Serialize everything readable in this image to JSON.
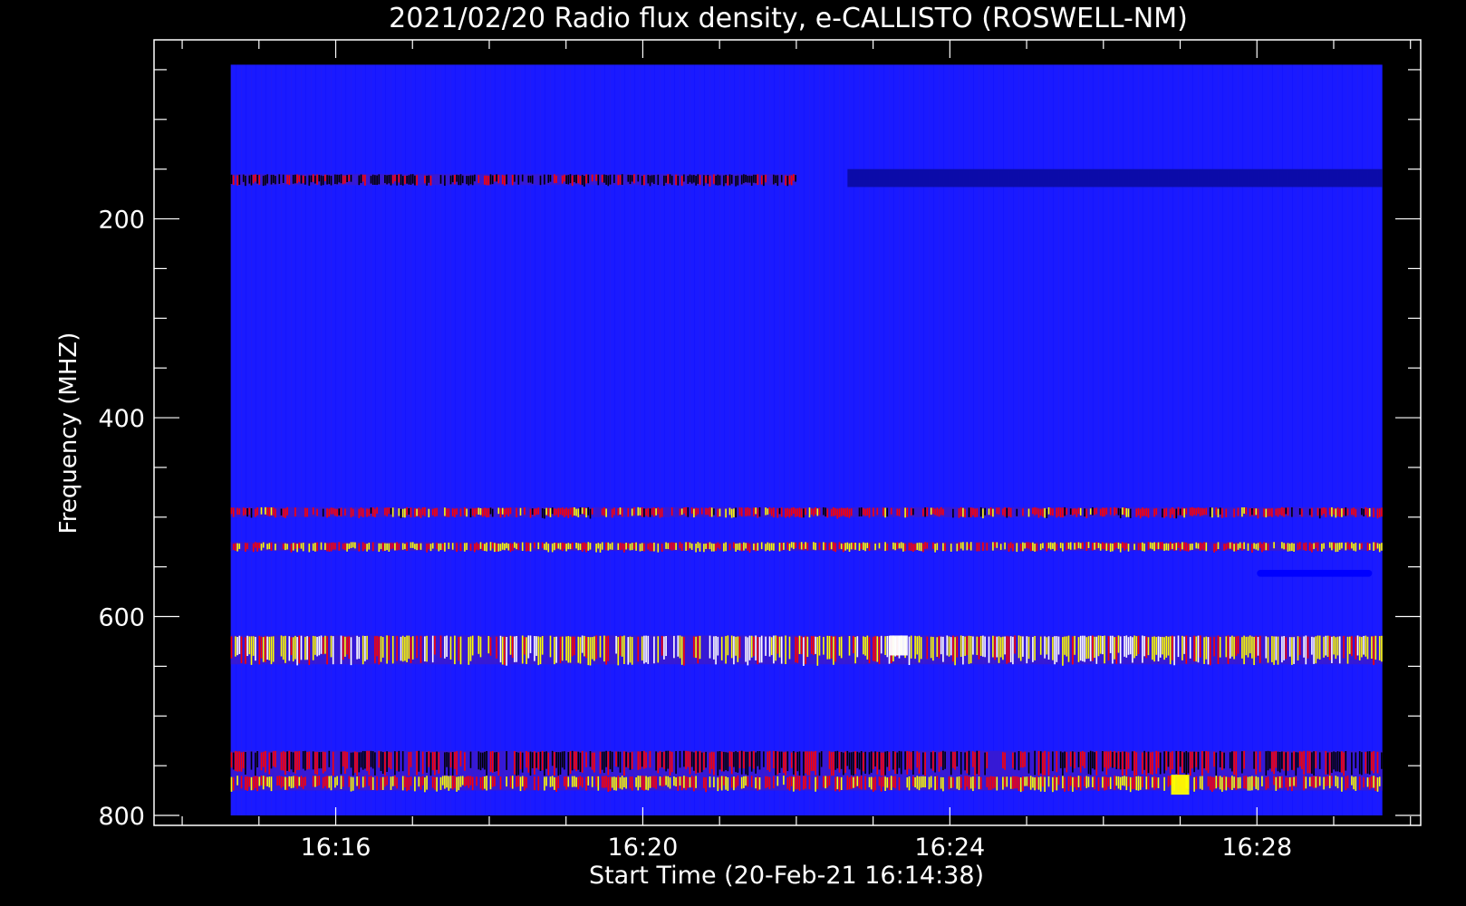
{
  "chart_data": {
    "type": "heatmap",
    "title": "2021/02/20  Radio flux density, e-CALLISTO (ROSWELL-NM)",
    "xlabel": "Start Time (20-Feb-21 16:14:38)",
    "ylabel": "Frequency (MHZ)",
    "x_axis": {
      "unit": "time (HH:MM, 20-Feb-21 UTC)",
      "range": [
        "16:14:38",
        "16:29:38"
      ],
      "plot_range": [
        "16:13:38",
        "16:30:08"
      ],
      "major_ticks": [
        "16:16",
        "16:20",
        "16:24",
        "16:28"
      ],
      "minor_tick_interval_s": 60
    },
    "y_axis": {
      "unit": "MHz",
      "inverted": true,
      "range": [
        45,
        800
      ],
      "plot_range": [
        20,
        810
      ],
      "major_ticks": [
        200,
        400,
        600,
        800
      ],
      "minor_tick_interval": 50
    },
    "grid": false,
    "colormap": [
      "#0000ff",
      "#000000",
      "#ff0000",
      "#ffff00",
      "#ffffff"
    ],
    "background_level": "#1a1aff",
    "bands": [
      {
        "freq_range": [
          155,
          166
        ],
        "time_range": [
          "16:14:38",
          "16:22:00"
        ],
        "intensity": 0.35
      },
      {
        "freq_range": [
          150,
          168
        ],
        "time_range": [
          "16:22:40",
          "16:29:38"
        ],
        "intensity": 0.1
      },
      {
        "freq_range": [
          490,
          500
        ],
        "time_range": [
          "16:14:38",
          "16:29:38"
        ],
        "intensity": 0.55
      },
      {
        "freq_range": [
          525,
          534
        ],
        "time_range": [
          "16:14:38",
          "16:29:38"
        ],
        "intensity": 0.7
      },
      {
        "freq_range": [
          619,
          648
        ],
        "time_range": [
          "16:14:38",
          "16:29:38"
        ],
        "intensity": 0.85
      },
      {
        "freq_range": [
          735,
          760
        ],
        "time_range": [
          "16:14:38",
          "16:29:38"
        ],
        "intensity": 0.4
      },
      {
        "freq_range": [
          760,
          775
        ],
        "time_range": [
          "16:14:38",
          "16:29:38"
        ],
        "intensity": 0.7
      }
    ],
    "notable_features": [
      {
        "freq": 630,
        "time": "16:23:20",
        "intensity": 1.0
      },
      {
        "freq": 770,
        "time": "16:27:00",
        "intensity": 0.8
      },
      {
        "freq_range": [
          553,
          560
        ],
        "time_range": [
          "16:28:00",
          "16:29:30"
        ],
        "intensity": 0.0
      }
    ]
  }
}
